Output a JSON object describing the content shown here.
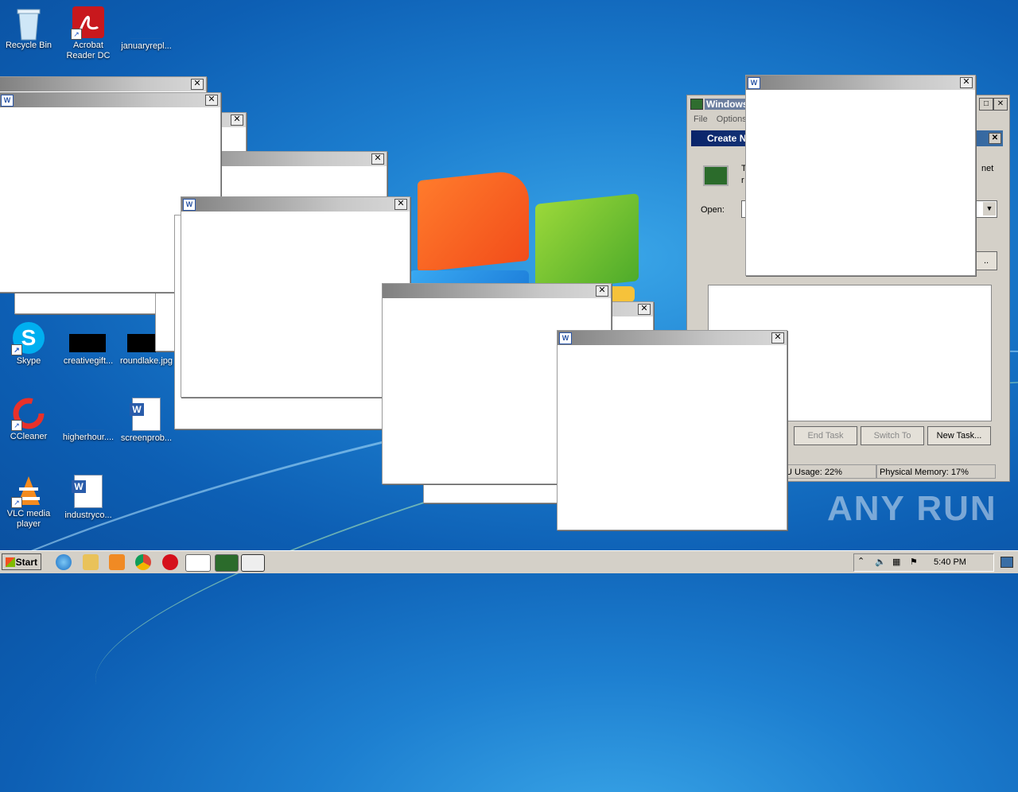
{
  "desktop": {
    "icons": [
      {
        "label": "Recycle Bin",
        "icon": "recycle-bin-icon"
      },
      {
        "label": "Acrobat Reader DC",
        "icon": "acrobat-icon"
      },
      {
        "label": "januaryrepl...",
        "icon": "file-icon"
      },
      {
        "label": "Skype",
        "icon": "skype-icon"
      },
      {
        "label": "creativegift...",
        "icon": "image-file-icon"
      },
      {
        "label": "roundlake.jpg",
        "icon": "image-file-icon"
      },
      {
        "label": "CCleaner",
        "icon": "ccleaner-icon"
      },
      {
        "label": "higherhour....",
        "icon": "file-icon"
      },
      {
        "label": "screenprob...",
        "icon": "word-doc-icon"
      },
      {
        "label": "VLC media player",
        "icon": "vlc-icon"
      },
      {
        "label": "industryco...",
        "icon": "word-doc-icon"
      }
    ]
  },
  "task_manager": {
    "title": "Windows",
    "menu": [
      "File",
      "Options"
    ],
    "dialog_title": "Create N",
    "text_line_1": "T",
    "text_line_1_end": "net",
    "text_line_2": "r",
    "open_label": "Open:",
    "buttons": {
      "end_task": "End Task",
      "switch_to": "Switch To",
      "new_task": "New Task..."
    },
    "partial_button": "..",
    "status": {
      "cpu": "U Usage: 22%",
      "memory": "Physical Memory: 17%"
    }
  },
  "taskbar": {
    "start_label": "Start",
    "clock": "5:40 PM"
  },
  "watermark": "ANY RUN",
  "colors": {
    "desktop": "#1d7fd0",
    "taskbar": "#d4d0c8",
    "titlebar_active": "#0a246a"
  }
}
